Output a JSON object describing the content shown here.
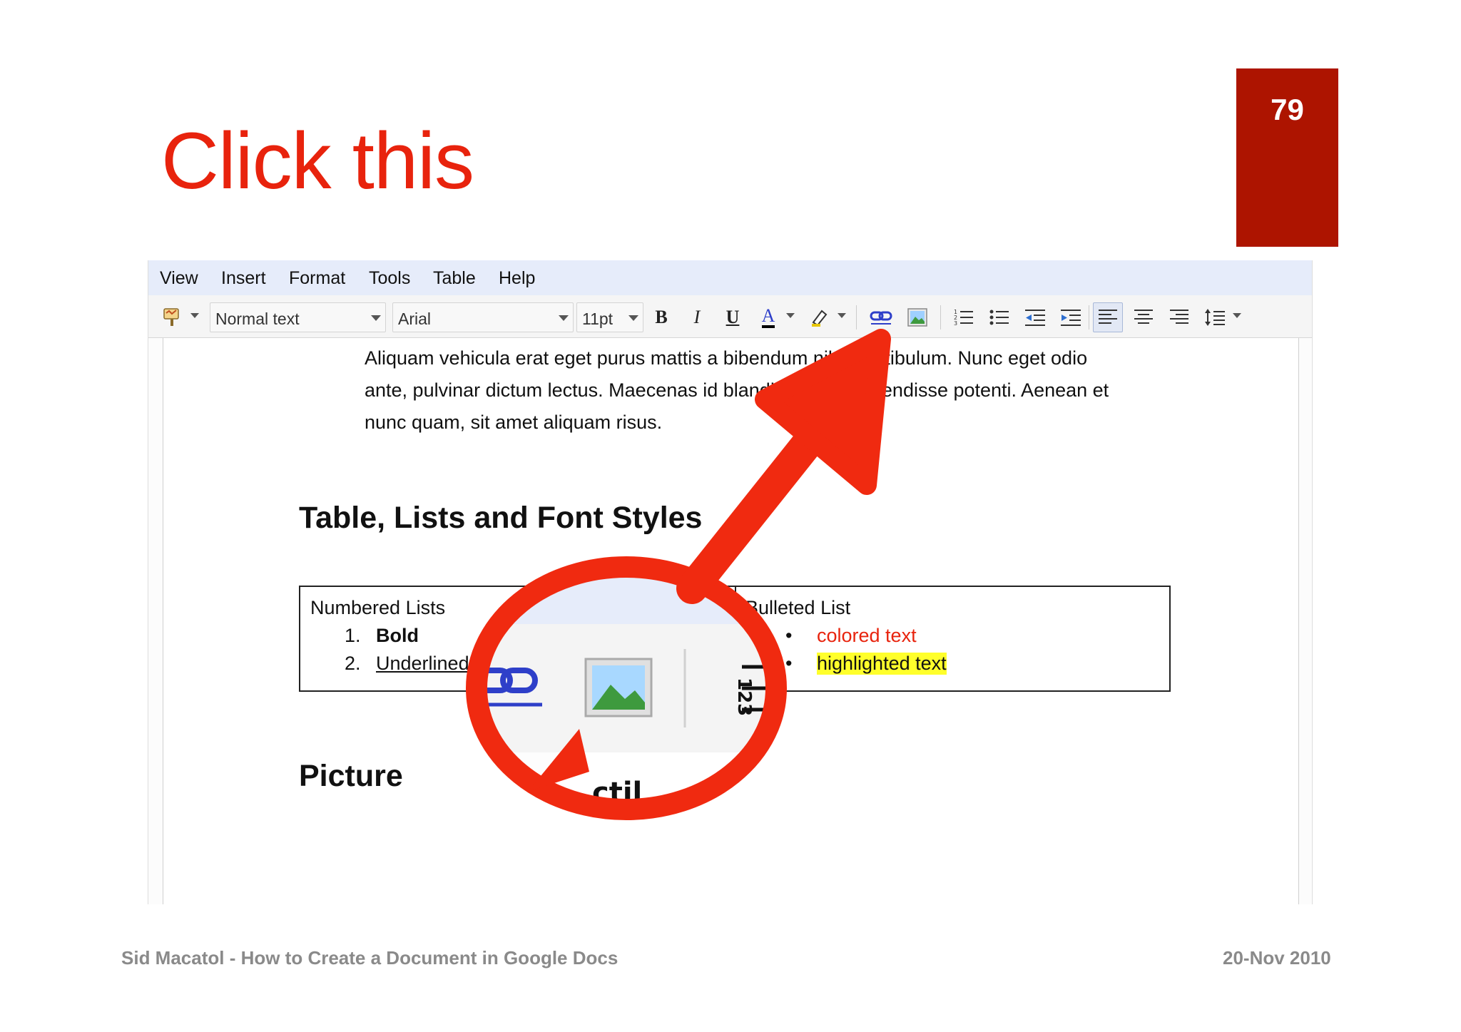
{
  "slide": {
    "title": "Click this",
    "page_number": "79",
    "footer_left": "Sid Macatol - How to Create a Document in Google Docs",
    "footer_right": "20-Nov 2010"
  },
  "menubar": {
    "items": [
      "View",
      "Insert",
      "Format",
      "Tools",
      "Table",
      "Help"
    ]
  },
  "toolbar": {
    "style_dropdown": "Normal text",
    "font_dropdown": "Arial",
    "size_dropdown": "11pt",
    "bold": "B",
    "italic": "I",
    "underline": "U",
    "text_color": "A",
    "icons": [
      "paint-format-icon",
      "bold-icon",
      "italic-icon",
      "underline-icon",
      "text-color-icon",
      "highlight-icon",
      "link-icon",
      "insert-image-icon",
      "numbered-list-icon",
      "bulleted-list-icon",
      "decrease-indent-icon",
      "increase-indent-icon",
      "align-left-icon",
      "align-center-icon",
      "align-right-icon",
      "line-spacing-icon"
    ]
  },
  "document": {
    "paragraph_lines": [
      "Aliquam vehicula erat eget purus mattis a bibendum nibh vestibulum. Nunc eget odio",
      "ante, pulvinar dictum lectus. Maecenas id blandit nunc. Suspendisse potenti. Aenean et",
      "nunc quam, sit amet aliquam risus."
    ],
    "heading_1": "Table, Lists and Font Styles",
    "table": {
      "left_title": "Numbered Lists",
      "numbered_items": [
        {
          "num": "1.",
          "text": "Bold"
        },
        {
          "num": "2.",
          "text": "Underlined"
        }
      ],
      "right_title": "Bulleted List",
      "bullet_items": [
        {
          "bullet": "•",
          "text": "colored text"
        },
        {
          "bullet": "•",
          "text": "highlighted text"
        }
      ]
    },
    "heading_2": "Picture"
  },
  "colors": {
    "title": "#e8230d",
    "badge": "#ad1400",
    "annotation": "#f02a10",
    "menubar": "#e6ecfa",
    "highlight": "#ffff2b",
    "link_blue": "#2e3fc9"
  }
}
